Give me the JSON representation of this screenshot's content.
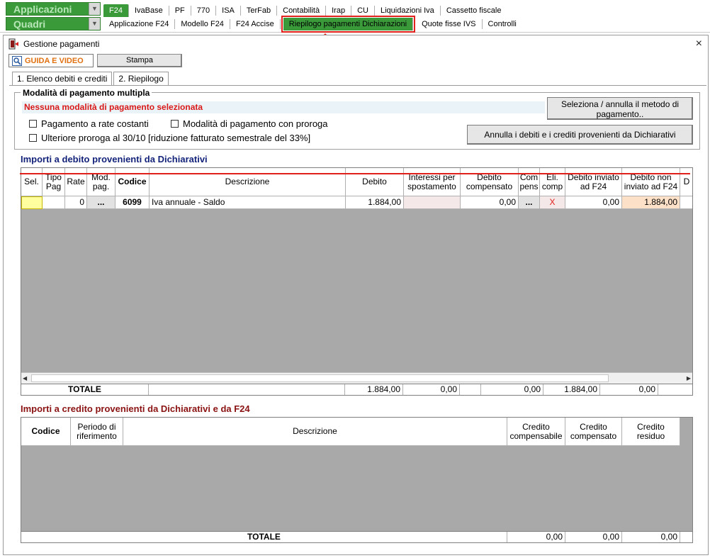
{
  "appbar": {
    "combo_apps": "Applicazioni",
    "combo_quadri": "Quadri",
    "menu_top": [
      "F24",
      "IvaBase",
      "PF",
      "770",
      "ISA",
      "TerFab",
      "Contabilità",
      "Irap",
      "CU",
      "Liquidazioni Iva",
      "Cassetto fiscale"
    ],
    "menu_bottom": [
      "Applicazione F24",
      "Modello F24",
      "F24 Accise",
      "Riepilogo pagamenti Dichiarazioni",
      "Quote fisse IVS",
      "Controlli"
    ]
  },
  "window": {
    "title": "Gestione pagamenti",
    "close": "×",
    "guida_label": "GUIDA E VIDEO",
    "stampa_label": "Stampa",
    "tabs": [
      "1. Elenco debiti e crediti",
      "2. Riepilogo"
    ]
  },
  "modalita": {
    "title": "Modalità di pagamento multipla",
    "status": "Nessuna modalità di pagamento selezionata",
    "chk_rate": "Pagamento a rate costanti",
    "chk_proroga": "Modalità di pagamento con proroga",
    "chk_ulteriore": "Ulteriore proroga al 30/10 [riduzione fatturato semestrale del 33%]",
    "btn_seleziona": "Seleziona / annulla il metodo di pagamento..",
    "btn_annulla": "Annulla i debiti e i crediti provenienti da Dichiarativi"
  },
  "debito": {
    "title": "Importi a debito provenienti da Dichiarativi",
    "headers": [
      "Sel.",
      "Tipo\nPag",
      "Rate",
      "Mod.\npag.",
      "Codice",
      "Descrizione",
      "Debito",
      "Interessi per\nspostamento",
      "Debito\ncompensato",
      "Com\npens",
      "Eli.\ncomp",
      "Debito inviato\nad F24",
      "Debito non\ninviato ad F24",
      "D"
    ],
    "row": {
      "sel": "",
      "tipo": "",
      "rate": "0",
      "mod": "...",
      "codice": "6099",
      "descrizione": "Iva annuale - Saldo",
      "debito": "1.884,00",
      "interessi": "",
      "compensato": "0,00",
      "compens": "...",
      "eli": "X",
      "inviato": "0,00",
      "non_inviato": "1.884,00",
      "extra": ""
    },
    "total": {
      "label": "TOTALE",
      "debito": "1.884,00",
      "interessi": "0,00",
      "compensato": "0,00",
      "inviato": "1.884,00",
      "non_inviato": "0,00"
    }
  },
  "credito": {
    "title": "Importi a credito provenienti da Dichiarativi e da F24",
    "headers": [
      "Codice",
      "Periodo di\nriferimento",
      "Descrizione",
      "Credito\ncompensabile",
      "Credito\ncompensato",
      "Credito\nresiduo"
    ],
    "total": {
      "label": "TOTALE",
      "compensabile": "0,00",
      "compensato": "0,00",
      "residuo": "0,00"
    }
  },
  "colors": {
    "green": "#3a9a3a",
    "highlight_red": "#e0201a",
    "grid_bg": "#a9a9a9",
    "debito_title": "#14237a",
    "credito_title": "#8a1212"
  }
}
